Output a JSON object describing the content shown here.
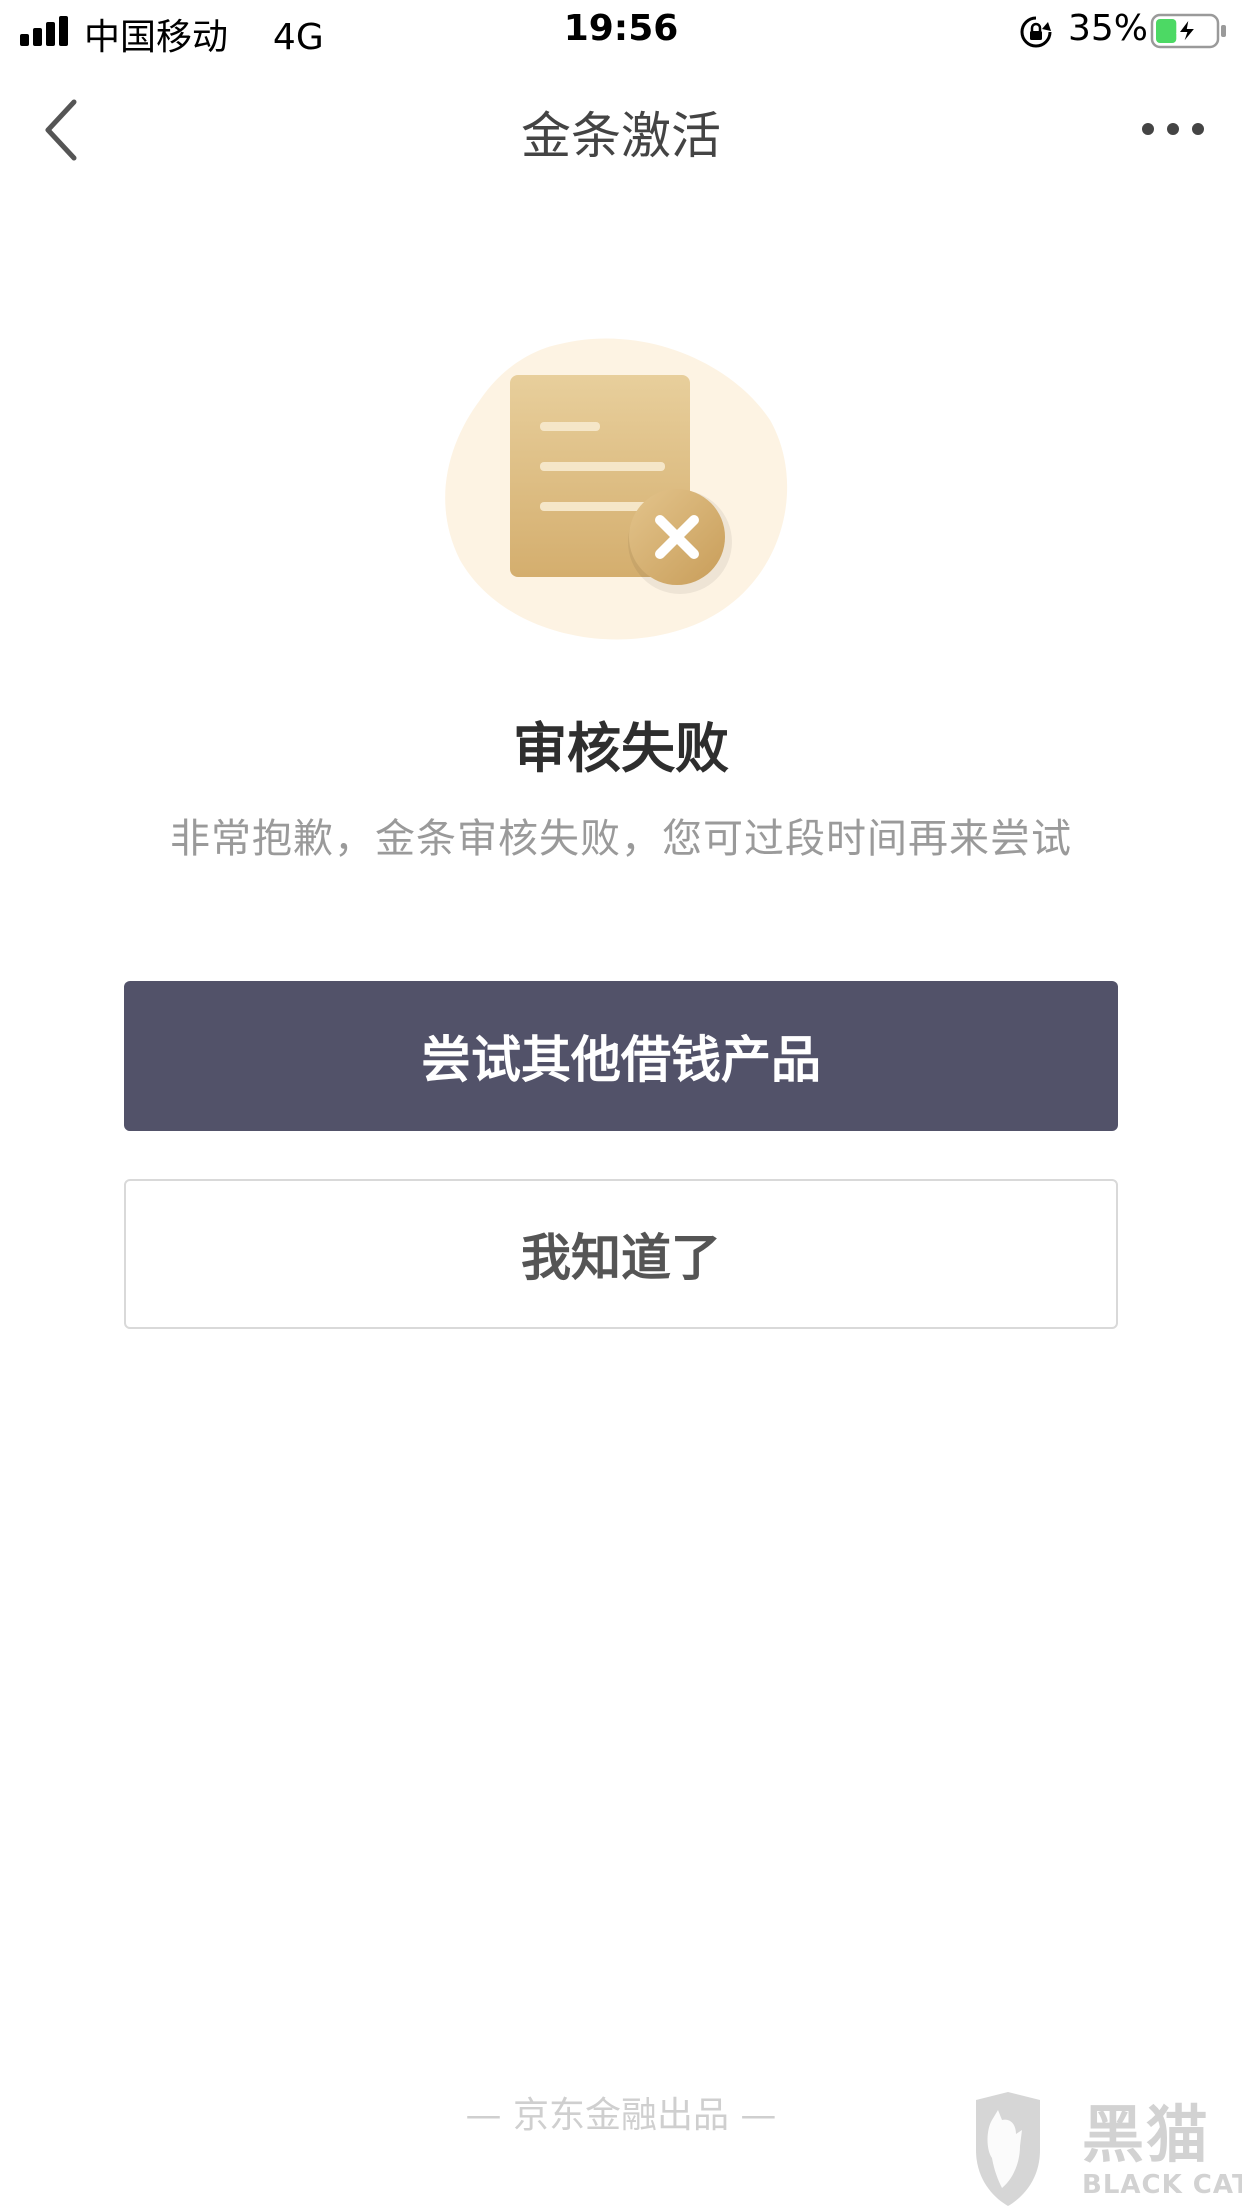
{
  "status_bar": {
    "carrier": "中国移动",
    "network": "4G",
    "time": "19:56",
    "battery_percent": "35%",
    "battery_level": 0.35,
    "icons": [
      "signal-icon",
      "rotation-lock-icon",
      "battery-charging-icon"
    ]
  },
  "nav": {
    "title": "金条激活",
    "back_icon": "chevron-left-icon",
    "more_icon": "more-dots-icon"
  },
  "result": {
    "illustration_icon": "document-rejected-icon",
    "title": "审核失败",
    "description": "非常抱歉，金条审核失败，您可过段时间再来尝试"
  },
  "actions": {
    "primary_label": "尝试其他借钱产品",
    "secondary_label": "我知道了"
  },
  "footer": {
    "note": "— 京东金融出品 —"
  },
  "watermark": {
    "brand_cn": "黑猫",
    "brand_en": "BLACK CAT"
  },
  "colors": {
    "primary_button": "#525269",
    "accent_gold": "#d8b77c",
    "battery_green": "#4cd964"
  }
}
